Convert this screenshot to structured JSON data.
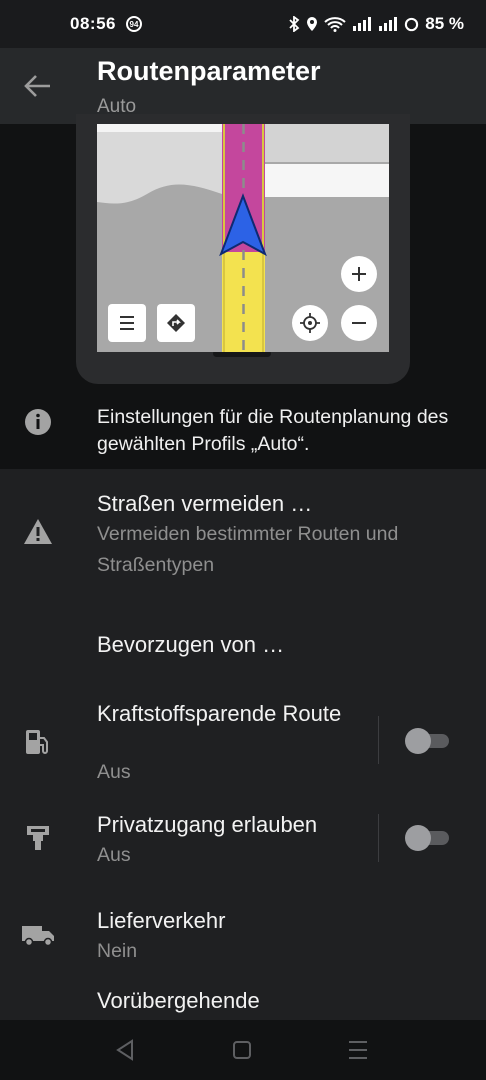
{
  "status": {
    "time": "08:56",
    "notif_badge": "94",
    "battery": "85 %"
  },
  "header": {
    "title": "Routenparameter",
    "subtitle": "Auto"
  },
  "info": {
    "text": "Einstellungen für die Routenplanung des gewählten Profils „Auto“."
  },
  "rows": [
    {
      "title": "Straßen vermeiden …",
      "subtitle": "Vermeiden bestimmter Routen und Straßentypen",
      "icon": "warning-icon"
    },
    {
      "title": "Bevorzugen von …"
    },
    {
      "title": "Kraftstoffsparende Route",
      "subtitle": "Aus",
      "icon": "fuel-pump-icon",
      "toggle": false
    },
    {
      "title": "Privatzugang erlauben",
      "subtitle": "Aus",
      "icon": "private-access-icon",
      "toggle": false
    },
    {
      "title": "Lieferverkehr",
      "subtitle": "Nein",
      "icon": "truck-icon"
    },
    {
      "title": "Vorübergehende"
    }
  ],
  "colors": {
    "route_magenta": "#c4479d",
    "route_yellow": "#f3e24f",
    "nav_arrow": "#2c62e6"
  }
}
